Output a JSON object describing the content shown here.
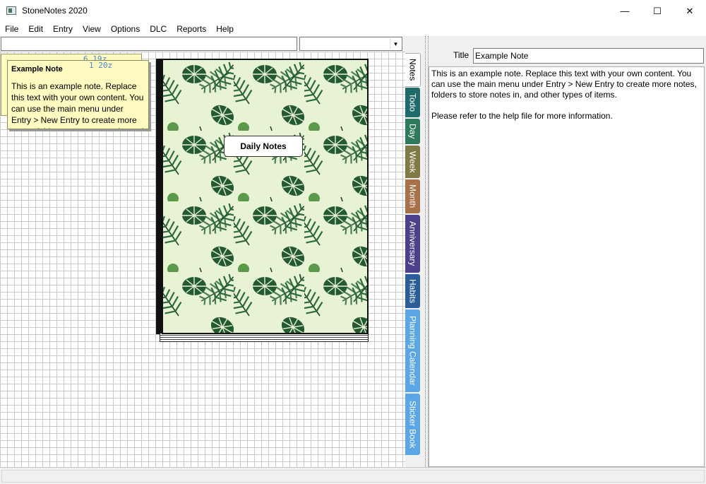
{
  "window": {
    "title": "StoneNotes 2020",
    "minimize": "—",
    "maximize": "☐",
    "close": "✕"
  },
  "menu": [
    "File",
    "Edit",
    "Entry",
    "View",
    "Options",
    "DLC",
    "Reports",
    "Help"
  ],
  "combo": {
    "dropdown_arrow": "▼"
  },
  "sticky_note": {
    "back_number": "6 19z",
    "front_number": "1 20z",
    "title": "Example Note",
    "body": "This is an example note. Replace this text with your own content. You can use the main menu under Entry > New Entry to create more notes, folders to store notes in, and other types of items."
  },
  "notebook": {
    "label": "Daily Notes"
  },
  "tabs": [
    {
      "label": "Notes",
      "color": "#ffffff",
      "active": true
    },
    {
      "label": "Todo",
      "color": "#1f6b6b"
    },
    {
      "label": "Day",
      "color": "#2e7a5c"
    },
    {
      "label": "Week",
      "color": "#7f7a46"
    },
    {
      "label": "Month",
      "color": "#a8714a"
    },
    {
      "label": "Anniversary",
      "color": "#4e3f8a"
    },
    {
      "label": "Habits",
      "color": "#2b5d9a"
    },
    {
      "label": "Planning Calendar",
      "color": "#5aa6e6"
    },
    {
      "label": "Sticker Book",
      "color": "#5aa6e6"
    }
  ],
  "editor": {
    "title_label": "Title",
    "title_value": "Example Note",
    "paragraph1": "This is an example note. Replace this text with your own content. You can use the main menu under Entry > New Entry to create more notes, folders to store notes in, and other types of items.",
    "paragraph2": "Please refer to the help file for more information."
  }
}
